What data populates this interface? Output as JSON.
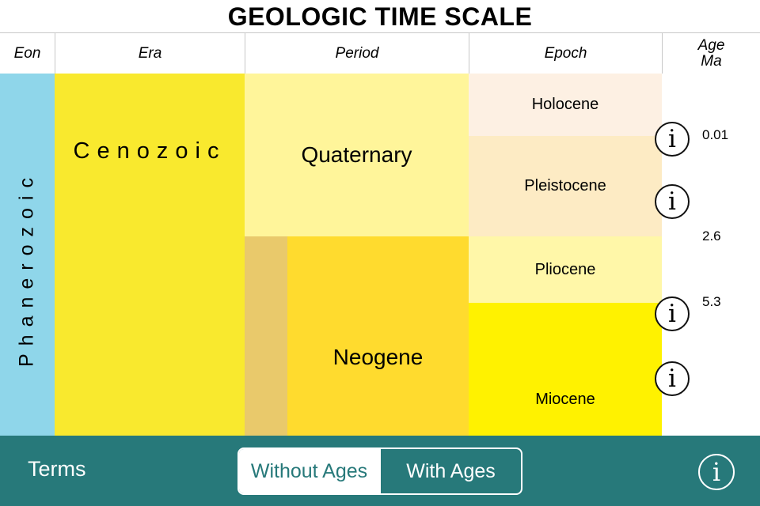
{
  "title": "GEOLOGIC TIME SCALE",
  "headers": {
    "eon": "Eon",
    "era": "Era",
    "period": "Period",
    "epoch": "Epoch",
    "age_line1": "Age",
    "age_line2": "Ma"
  },
  "eon": {
    "name": "Phanerozoic",
    "color": "#8fd6ea"
  },
  "era": {
    "name": "Cenozoic",
    "color": "#f9e92e"
  },
  "periods": [
    {
      "name": "Quaternary",
      "color": "#fff59a"
    },
    {
      "name": "Neogene",
      "color": "#ffdb2e",
      "strip_color": "#e9c96b"
    }
  ],
  "epochs": [
    {
      "name": "Holocene",
      "color": "#fdf0e3"
    },
    {
      "name": "Pleistocene",
      "color": "#fdebc4"
    },
    {
      "name": "Pliocene",
      "color": "#fff7a8"
    },
    {
      "name": "Miocene",
      "color": "#fff200"
    }
  ],
  "ages": [
    "0.01",
    "2.6",
    "5.3"
  ],
  "info_icon_glyph": "i",
  "bottom_bar": {
    "color": "#27797a",
    "terms_label": "Terms",
    "segments": [
      {
        "label": "Without Ages",
        "selected": true
      },
      {
        "label": "With Ages",
        "selected": false
      }
    ],
    "info_glyph": "i"
  }
}
